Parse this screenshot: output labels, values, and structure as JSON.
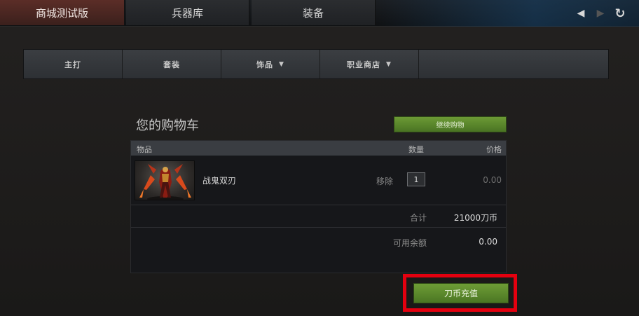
{
  "top_tabs": [
    {
      "label": "商城测试版",
      "active": true
    },
    {
      "label": "兵器库",
      "active": false
    },
    {
      "label": "装备",
      "active": false
    }
  ],
  "nav": {
    "back_icon": "back-arrow-icon",
    "forward_icon": "forward-arrow-icon",
    "refresh_icon": "refresh-icon"
  },
  "categories": [
    {
      "label": "主打",
      "has_dropdown": false
    },
    {
      "label": "套装",
      "has_dropdown": false
    },
    {
      "label": "饰品",
      "has_dropdown": true
    },
    {
      "label": "职业商店",
      "has_dropdown": true
    }
  ],
  "cart": {
    "title": "您的购物车",
    "continue_label": "继续购物",
    "headers": {
      "item": "物品",
      "quantity": "数量",
      "price": "价格"
    },
    "items": [
      {
        "name": "战鬼双刃",
        "remove_label": "移除",
        "quantity": "1",
        "price": "0.00"
      }
    ],
    "total_label": "合计",
    "total_value": "21000刀币",
    "balance_label": "可用余额",
    "balance_value": "0.00",
    "recharge_label": "刀币充值"
  },
  "colors": {
    "accent_green": "#5a8a2c",
    "active_tab": "#4a2622",
    "highlight_red": "#e4000f"
  }
}
